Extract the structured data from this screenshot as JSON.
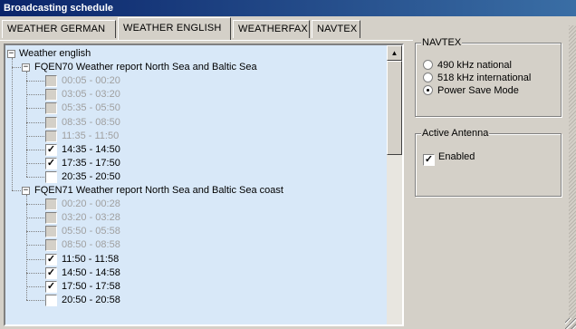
{
  "window": {
    "title": "Broadcasting schedule"
  },
  "tabs": [
    {
      "label": "WEATHER GERMAN",
      "active": false
    },
    {
      "label": "WEATHER ENGLISH",
      "active": true
    },
    {
      "label": "WEATHERFAX",
      "active": false
    },
    {
      "label": "NAVTEX",
      "active": false
    }
  ],
  "tree": {
    "root_label": "Weather english",
    "root_expander": "−",
    "groups": [
      {
        "label": "FQEN70 Weather report North Sea and Baltic Sea",
        "expander": "−",
        "items": [
          {
            "label": "00:05 - 00:20",
            "enabled": false,
            "checked": false
          },
          {
            "label": "03:05 - 03:20",
            "enabled": false,
            "checked": false
          },
          {
            "label": "05:35 - 05:50",
            "enabled": false,
            "checked": false
          },
          {
            "label": "08:35 - 08:50",
            "enabled": false,
            "checked": false
          },
          {
            "label": "11:35 - 11:50",
            "enabled": false,
            "checked": false
          },
          {
            "label": "14:35 - 14:50",
            "enabled": true,
            "checked": true
          },
          {
            "label": "17:35 - 17:50",
            "enabled": true,
            "checked": true
          },
          {
            "label": "20:35 - 20:50",
            "enabled": true,
            "checked": false
          }
        ]
      },
      {
        "label": "FQEN71 Weather report North Sea and Baltic Sea coast",
        "expander": "−",
        "items": [
          {
            "label": "00:20 - 00:28",
            "enabled": false,
            "checked": false
          },
          {
            "label": "03:20 - 03:28",
            "enabled": false,
            "checked": false
          },
          {
            "label": "05:50 - 05:58",
            "enabled": false,
            "checked": false
          },
          {
            "label": "08:50 - 08:58",
            "enabled": false,
            "checked": false
          },
          {
            "label": "11:50 - 11:58",
            "enabled": true,
            "checked": true
          },
          {
            "label": "14:50 - 14:58",
            "enabled": true,
            "checked": true
          },
          {
            "label": "17:50 - 17:58",
            "enabled": true,
            "checked": true
          },
          {
            "label": "20:50 - 20:58",
            "enabled": true,
            "checked": false
          }
        ]
      }
    ]
  },
  "navtex": {
    "title": "NAVTEX",
    "options": [
      {
        "label": "490 kHz national",
        "selected": false
      },
      {
        "label": "518 kHz international",
        "selected": false
      },
      {
        "label": "Power Save Mode",
        "selected": true
      }
    ]
  },
  "antenna": {
    "title": "Active Antenna",
    "enabled_label": "Enabled",
    "enabled": true
  },
  "scrollbar": {
    "up_arrow": "▲"
  },
  "colors": {
    "tree_bg": "#d8e8f8",
    "title_bg": "#0a246a",
    "window_bg": "#d4d0c8",
    "disabled_text": "#a0a0a0"
  }
}
